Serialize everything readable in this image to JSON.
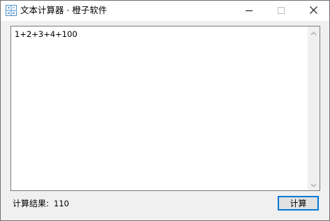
{
  "window": {
    "title": "文本计算器 · 橙子软件"
  },
  "icons": {
    "app": "calculator-grid-icon",
    "minimize": "minimize-icon",
    "maximize": "maximize-icon",
    "close": "close-icon",
    "scroll_up": "chevron-up-icon",
    "scroll_down": "chevron-down-icon"
  },
  "editor": {
    "value": "1+2+3+4+100"
  },
  "result": {
    "label": "计算结果:",
    "value": "110"
  },
  "actions": {
    "calculate_label": "计算"
  },
  "colors": {
    "accent": "#0078d7",
    "icon_blue": "#4a90c8"
  }
}
